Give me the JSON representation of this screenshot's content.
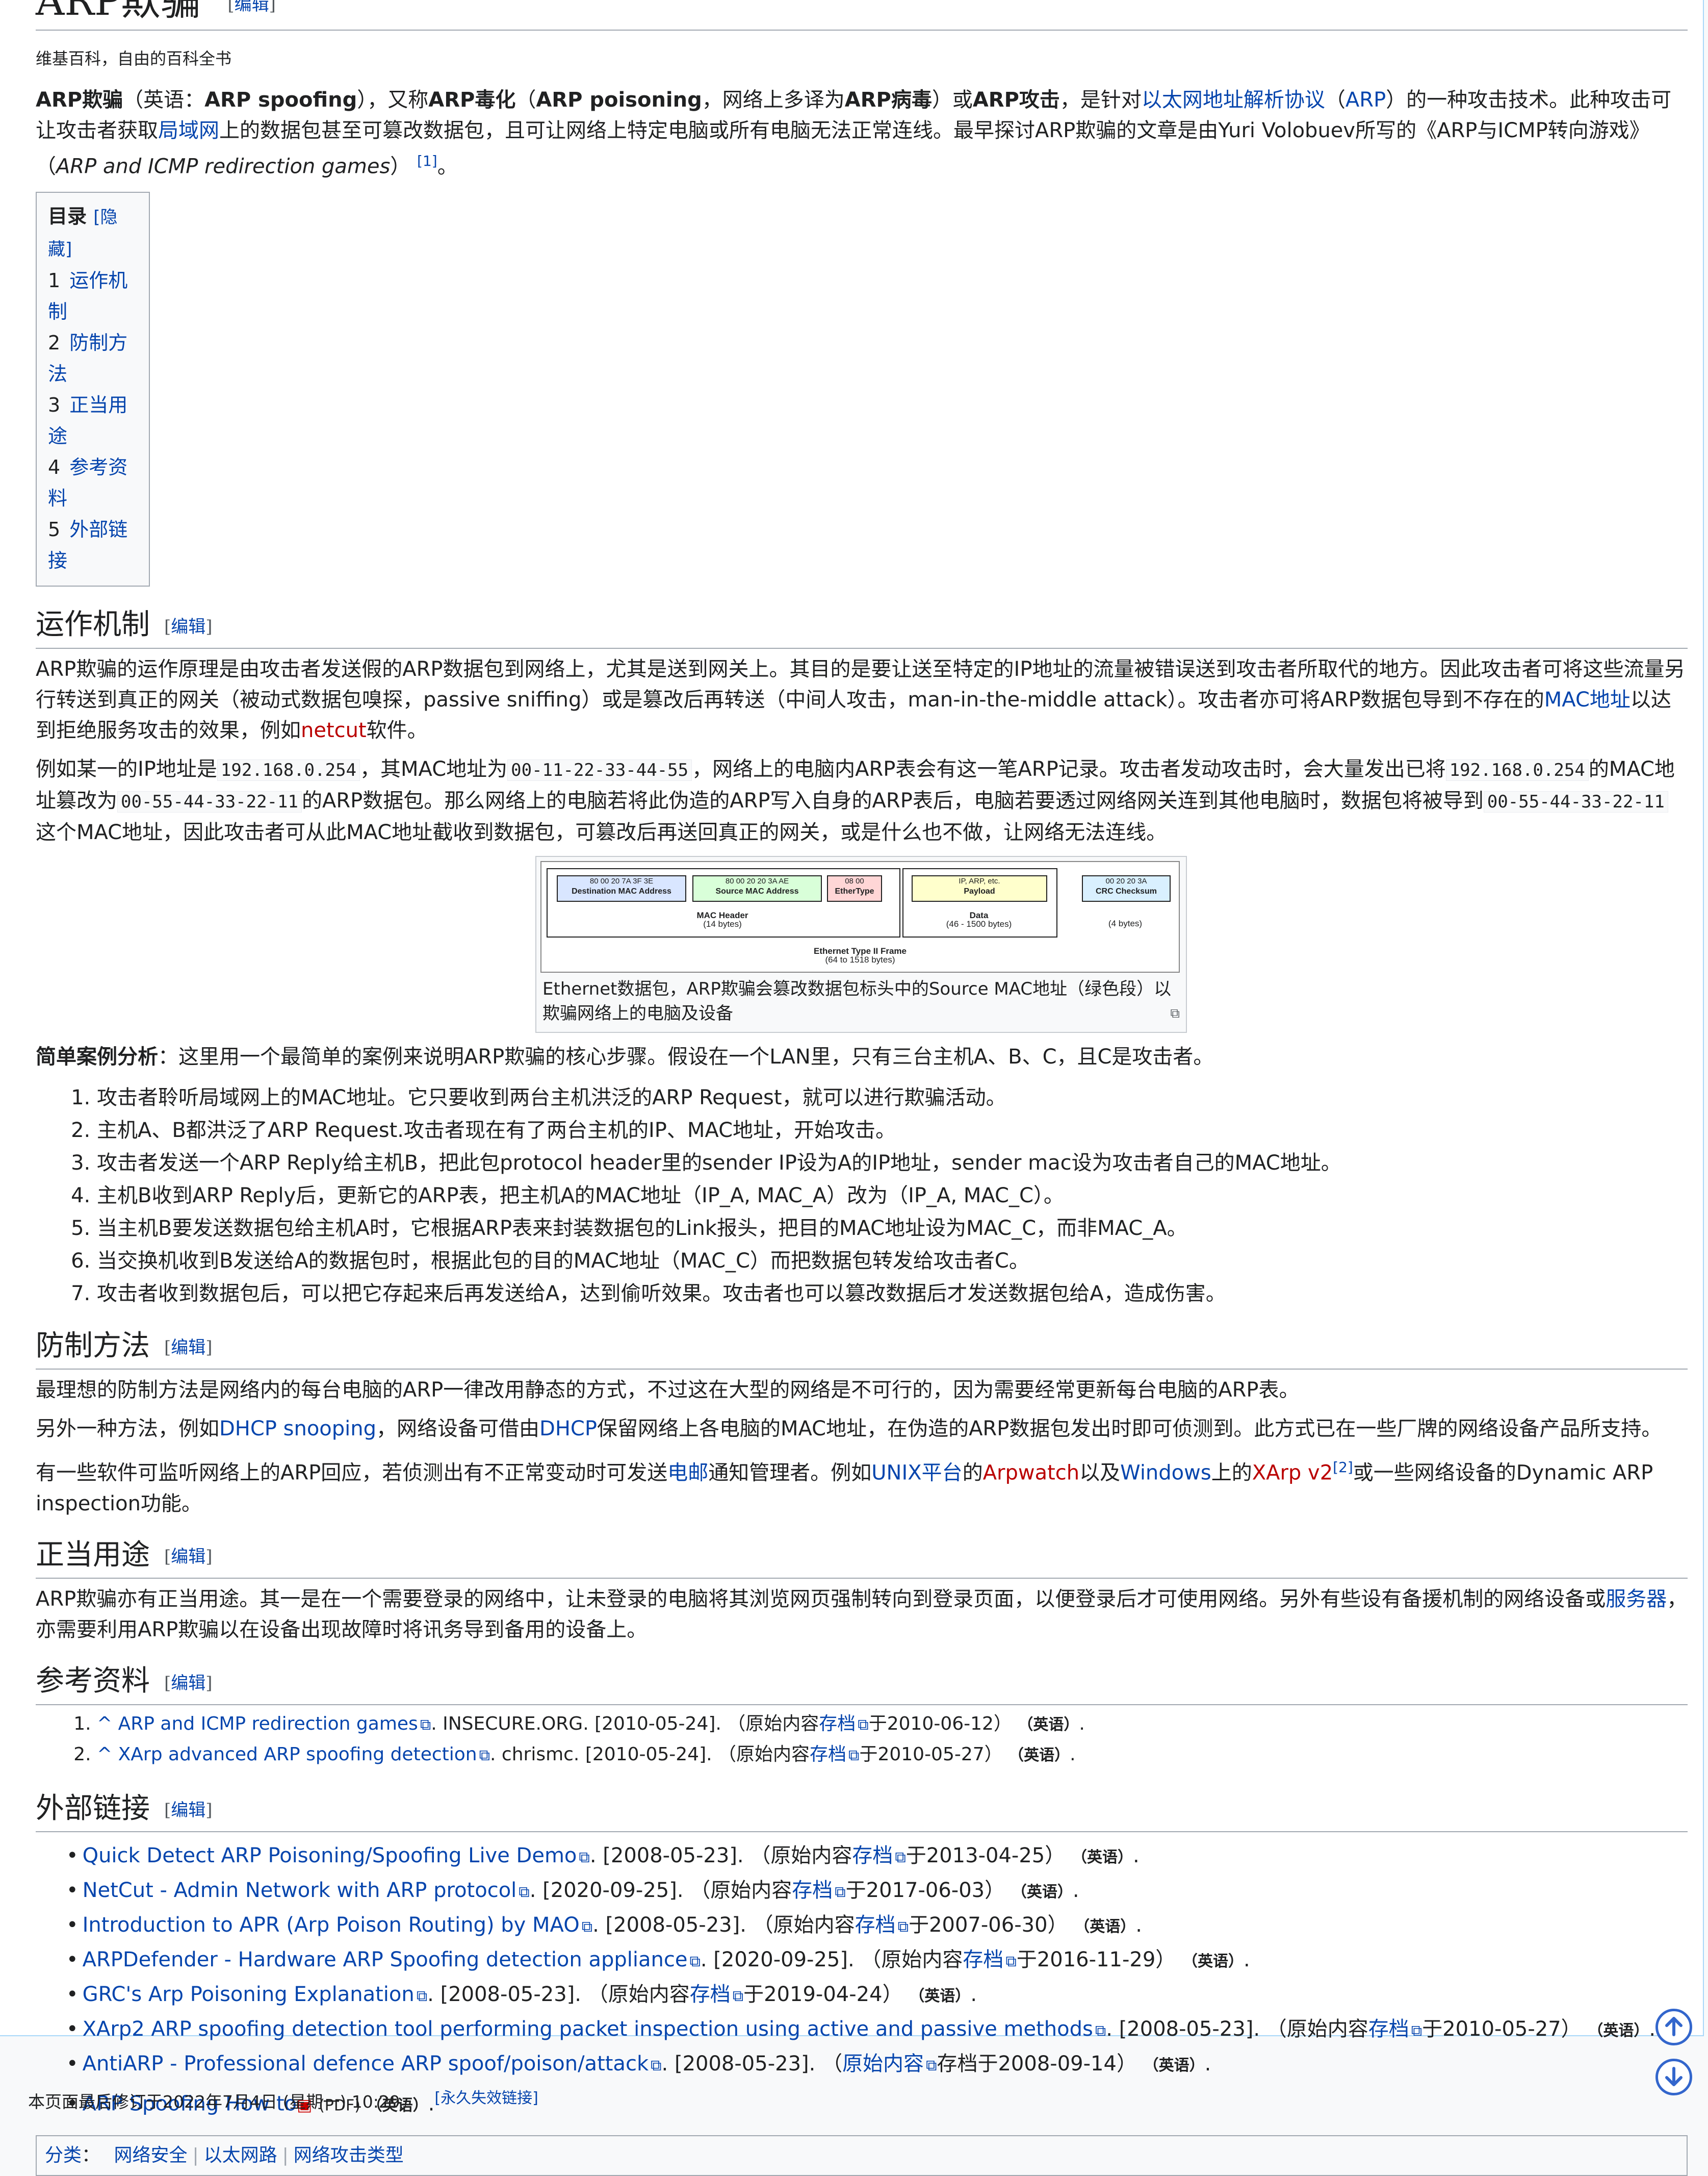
{
  "title": "ARP欺骗",
  "edit_label": "编辑",
  "tagline": "维基百科，自由的百科全书",
  "intro": {
    "b1": "ARP欺骗",
    "t1": "（英语：",
    "b2": "ARP spoofing",
    "t2": "），又称",
    "b3": "ARP毒化",
    "t3": "（",
    "b4": "ARP poisoning",
    "t4": "，网络上多译为",
    "b5": "ARP病毒",
    "t5": "）或",
    "b6": "ARP攻击",
    "t6": "，是针对",
    "l1": "以太网地址解析协议",
    "t7": "（",
    "l2": "ARP",
    "t8": "）的一种攻击技术。此种攻击可让攻击者获取",
    "l3": "局域网",
    "t9": "上的数据包甚至可篡改数据包，且可让网络上特定电脑或所有电脑无法正常连线。最早探讨ARP欺骗的文章是由Yuri Volobuev所写的《ARP与ICMP转向游戏》（",
    "i1": "ARP and ICMP redirection games",
    "t10": "）",
    "ref": "[1]",
    "t11": "。"
  },
  "toc": {
    "title": "目录",
    "toggle": "[隐藏]",
    "items": [
      {
        "num": "1",
        "label": "运作机制"
      },
      {
        "num": "2",
        "label": "防制方法"
      },
      {
        "num": "3",
        "label": "正当用途"
      },
      {
        "num": "4",
        "label": "参考资料"
      },
      {
        "num": "5",
        "label": "外部链接"
      }
    ]
  },
  "s1": {
    "heading": "运作机制",
    "p1a": "ARP欺骗的运作原理是由攻击者发送假的ARP数据包到网络上，尤其是送到网关上。其目的是要让送至特定的IP地址的流量被错误送到攻击者所取代的地方。因此攻击者可将这些流量另行转送到真正的网关（被动式数据包嗅探，passive sniffing）或是篡改后再转送（中间人攻击，man-in-the-middle attack）。攻击者亦可将ARP数据包导到不存在的",
    "p1link": "MAC地址",
    "p1b": "以达到拒绝服务攻击的效果，例如",
    "p1red": "netcut",
    "p1c": "软件。",
    "p2a": "例如某一的IP地址是",
    "ip": "192.168.0.254",
    "p2b": "，其MAC地址为",
    "mac1": "00-11-22-33-44-55",
    "p2c": "，网络上的电脑内ARP表会有这一笔ARP记录。攻击者发动攻击时，会大量发出已将",
    "ip2": "192.168.0.254",
    "p2d": "的MAC地址篡改为",
    "mac2": "00-55-44-33-22-11",
    "p2e": "的ARP数据包。那么网络上的电脑若将此伪造的ARP写入自身的ARP表后，电脑若要透过网络网关连到其他电脑时，数据包将被导到",
    "mac3": "00-55-44-33-22-11",
    "p2f": "这个MAC地址，因此攻击者可从此MAC地址截收到数据包，可篡改后再送回真正的网关，或是什么也不做，让网络无法连线。",
    "caption": "Ethernet数据包，ARP欺骗会篡改数据包标头中的Source MAC地址（绿色段）以欺骗网络上的电脑及设备",
    "case_bold": "简单案例分析",
    "case_text": "：这里用一个最简单的案例来说明ARP欺骗的核心步骤。假设在一个LAN里，只有三台主机A、B、C，且C是攻击者。",
    "steps": [
      "攻击者聆听局域网上的MAC地址。它只要收到两台主机洪泛的ARP Request，就可以进行欺骗活动。",
      "主机A、B都洪泛了ARP Request.攻击者现在有了两台主机的IP、MAC地址，开始攻击。",
      "攻击者发送一个ARP Reply给主机B，把此包protocol header里的sender IP设为A的IP地址，sender mac设为攻击者自己的MAC地址。",
      "主机B收到ARP Reply后，更新它的ARP表，把主机A的MAC地址（IP_A, MAC_A）改为（IP_A, MAC_C）。",
      "当主机B要发送数据包给主机A时，它根据ARP表来封装数据包的Link报头，把目的MAC地址设为MAC_C，而非MAC_A。",
      "当交换机收到B发送给A的数据包时，根据此包的目的MAC地址（MAC_C）而把数据包转发给攻击者C。",
      "攻击者收到数据包后，可以把它存起来后再发送给A，达到偷听效果。攻击者也可以篡改数据后才发送数据包给A，造成伤害。"
    ]
  },
  "frame": {
    "dest_hex": "80  00  20  7A  3F  3E",
    "dest_label": "Destination MAC Address",
    "src_hex": "80  00  20  20  3A  AE",
    "src_label": "Source MAC Address",
    "type_hex": "08  00",
    "type_label": "EtherType",
    "payload_hex": "IP, ARP, etc.",
    "payload_label": "Payload",
    "crc_hex": "00  20  20  3A",
    "crc_label": "CRC Checksum",
    "mac_header": "MAC Header",
    "mac_header_sub": "(14 bytes)",
    "data": "Data",
    "data_sub": "(46 - 1500 bytes)",
    "crc_sub": "(4 bytes)",
    "frame_title": "Ethernet Type II Frame",
    "frame_sub": "(64 to 1518 bytes)",
    "colors": {
      "dest": "#d9e6ff",
      "src": "#d9ffd9",
      "type": "#ffd6d6",
      "payload": "#ffffcc",
      "crc": "#d9f0ff"
    }
  },
  "s2": {
    "heading": "防制方法",
    "p1": "最理想的防制方法是网络内的每台电脑的ARP一律改用静态的方式，不过这在大型的网络是不可行的，因为需要经常更新每台电脑的ARP表。",
    "p2a": "另外一种方法，例如",
    "p2l1": "DHCP snooping",
    "p2b": "，网络设备可借由",
    "p2l2": "DHCP",
    "p2c": "保留网络上各电脑的MAC地址，在伪造的ARP数据包发出时即可侦测到。此方式已在一些厂牌的网络设备产品所支持。",
    "p3a": "有一些软件可监听网络上的ARP回应，若侦测出有不正常变动时可发送",
    "p3l1": "电邮",
    "p3b": "通知管理者。例如",
    "p3l2": "UNIX平台",
    "p3c": "的",
    "p3r1": "Arpwatch",
    "p3d": "以及",
    "p3l3": "Windows",
    "p3e": "上的",
    "p3r2": "XArp v2",
    "p3ref": "[2]",
    "p3f": "或一些网络设备的Dynamic ARP inspection功能。"
  },
  "s3": {
    "heading": "正当用途",
    "pa": "ARP欺骗亦有正当用途。其一是在一个需要登录的网络中，让未登录的电脑将其浏览网页强制转向到登录页面，以便登录后才可使用网络。另外有些设有备援机制的网络设备或",
    "plink": "服务器",
    "pb": "，亦需要利用ARP欺骗以在设备出现故障时将讯务导到备用的设备上。"
  },
  "s4": {
    "heading": "参考资料",
    "refs": [
      {
        "caret": "^",
        "link": "ARP and ICMP redirection games",
        "src": ". INSECURE.ORG. [2010-05-24]. （原始内容",
        "archive": "存档",
        "date": "于2010-06-12）",
        "lang": "（英语）",
        "end": "."
      },
      {
        "caret": "^",
        "link": "XArp advanced ARP spoofing detection",
        "src": ". chrismc. [2010-05-24]. （原始内容",
        "archive": "存档",
        "date": "于2010-05-27）",
        "lang": "（英语）",
        "end": "."
      }
    ]
  },
  "s5": {
    "heading": "外部链接",
    "links": [
      {
        "link": "Quick Detect ARP Poisoning/Spoofing Live Demo",
        "src": ". [2008-05-23]. （原始内容",
        "archive": "存档",
        "date": "于2013-04-25）",
        "lang": "（英语）",
        "end": "."
      },
      {
        "link": "NetCut - Admin Network with ARP protocol",
        "src": ". [2020-09-25]. （原始内容",
        "archive": "存档",
        "date": "于2017-06-03）",
        "lang": "（英语）",
        "end": "."
      },
      {
        "link": "Introduction to APR (Arp Poison Routing) by MAO",
        "src": ". [2008-05-23]. （原始内容",
        "archive": "存档",
        "date": "于2007-06-30）",
        "lang": "（英语）",
        "end": "."
      },
      {
        "link": "ARPDefender - Hardware ARP Spoofing detection appliance",
        "src": ". [2020-09-25]. （原始内容",
        "archive": "存档",
        "date": "于2016-11-29）",
        "lang": "（英语）",
        "end": "."
      },
      {
        "link": "GRC's Arp Poisoning Explanation",
        "src": ". [2008-05-23]. （原始内容",
        "archive": "存档",
        "date": "于2019-04-24）",
        "lang": "（英语）",
        "end": "."
      },
      {
        "link": "XArp2 ARP spoofing detection tool performing packet inspection using active and passive methods",
        "src": ". [2008-05-23]. （原始内容",
        "archive": "存档",
        "date": "于2010-05-27）",
        "lang": "（英语）",
        "end": "."
      }
    ],
    "anti": {
      "link": "AntiARP - Professional defence ARP spoof/poison/attack",
      "src": ". [2008-05-23]. （",
      "archive": "原始内容",
      "date": "存档于2008-09-14）",
      "lang": "（英语）",
      "end": "."
    },
    "howto": {
      "link": "ARP Spoofing How to",
      "pdf": "(PDF)",
      "lang": "（英语）",
      "end": ".",
      "dead": "[永久失效链接]"
    }
  },
  "categories": {
    "label": "分类",
    "items": [
      "网络安全",
      "以太网路",
      "网络攻击类型"
    ]
  },
  "footer": "本页面最后修订于2022年7月4日 (星期一) 10:29。",
  "icons": [
    "external-link-icon",
    "pdf-icon",
    "expand-image-icon",
    "scroll-up-icon",
    "scroll-down-icon"
  ]
}
